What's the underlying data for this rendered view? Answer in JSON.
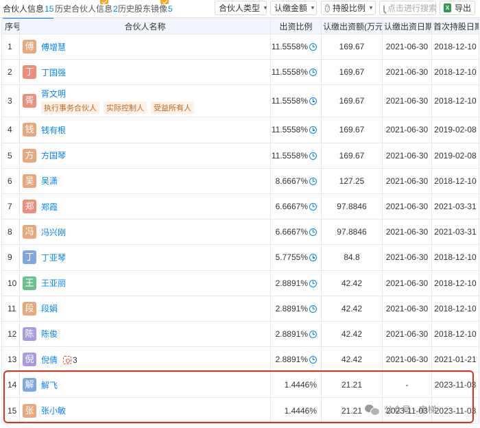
{
  "tabs": [
    {
      "label": "合伙人信息",
      "count": "15"
    },
    {
      "label": "历史合伙人信息",
      "count": "2"
    },
    {
      "label": "历史股东镜像",
      "count": "5"
    }
  ],
  "toolbar": {
    "partner_type": "合伙人类型",
    "amount": "认缴金额",
    "ratio": "持股比例",
    "search_placeholder": "点击进行搜索",
    "export": "导出"
  },
  "columns": [
    "序号",
    "合伙人名称",
    "出资比例",
    "认缴出资额(万元)",
    "认缴出资日期",
    "首次持股日期"
  ],
  "rows": [
    {
      "seq": "1",
      "avatar_char": "傅",
      "avatar_color": "#e8a87c",
      "name": "傅增慧",
      "ratio": "11.5558%",
      "amount": "169.67",
      "sub_date": "2021-06-30",
      "first_date": "2018-12-10"
    },
    {
      "seq": "2",
      "avatar_char": "丁",
      "avatar_color": "#ee8d7a",
      "name": "丁国强",
      "ratio": "11.5558%",
      "amount": "169.67",
      "sub_date": "2021-06-30",
      "first_date": "2018-12-10"
    },
    {
      "seq": "3",
      "avatar_char": "胥",
      "avatar_color": "#ee8d7a",
      "name": "胥文明",
      "tags": [
        "执行事务合伙人",
        "实际控制人",
        "受益所有人"
      ],
      "ratio": "11.5558%",
      "amount": "169.67",
      "sub_date": "2021-06-30",
      "first_date": "2018-12-10"
    },
    {
      "seq": "4",
      "avatar_char": "钱",
      "avatar_color": "#e8a87c",
      "name": "钱有根",
      "ratio": "11.5558%",
      "amount": "169.67",
      "sub_date": "2021-06-30",
      "first_date": "2019-02-08"
    },
    {
      "seq": "5",
      "avatar_char": "方",
      "avatar_color": "#e8a87c",
      "name": "方国琴",
      "ratio": "11.5558%",
      "amount": "169.67",
      "sub_date": "2021-06-30",
      "first_date": "2019-02-08"
    },
    {
      "seq": "6",
      "avatar_char": "吴",
      "avatar_color": "#e8a87c",
      "name": "吴潇",
      "ratio": "8.6667%",
      "amount": "127.25",
      "sub_date": "2021-06-30",
      "first_date": "2018-12-10"
    },
    {
      "seq": "7",
      "avatar_char": "郑",
      "avatar_color": "#ee8d7a",
      "name": "郑霞",
      "ratio": "6.6667%",
      "amount": "97.8846",
      "sub_date": "2021-06-30",
      "first_date": "2021-03-31"
    },
    {
      "seq": "8",
      "avatar_char": "冯",
      "avatar_color": "#e8a87c",
      "name": "冯兴刚",
      "ratio": "6.6667%",
      "amount": "97.8846",
      "sub_date": "2021-06-30",
      "first_date": "2021-03-31"
    },
    {
      "seq": "9",
      "avatar_char": "丁",
      "avatar_color": "#7fa8e0",
      "name": "丁亚琴",
      "ratio": "5.7755%",
      "amount": "84.8",
      "sub_date": "2021-06-30",
      "first_date": "2018-12-10"
    },
    {
      "seq": "10",
      "avatar_char": "王",
      "avatar_color": "#6cc08b",
      "name": "王亚丽",
      "ratio": "2.8891%",
      "amount": "42.42",
      "sub_date": "2021-06-30",
      "first_date": "2018-12-10"
    },
    {
      "seq": "11",
      "avatar_char": "段",
      "avatar_color": "#e8a87c",
      "name": "段娟",
      "ratio": "2.8891%",
      "amount": "42.42",
      "sub_date": "2021-06-30",
      "first_date": "2018-12-10"
    },
    {
      "seq": "12",
      "avatar_char": "陈",
      "avatar_color": "#a99be0",
      "name": "陈俊",
      "ratio": "2.8891%",
      "amount": "42.42",
      "sub_date": "2021-06-30",
      "first_date": "2018-12-10"
    },
    {
      "seq": "13",
      "avatar_char": "倪",
      "avatar_color": "#a99be0",
      "name": "倪倩",
      "link_count": "3",
      "ratio": "2.8891%",
      "amount": "42.42",
      "sub_date": "2021-06-30",
      "first_date": "2021-01-21"
    },
    {
      "seq": "14",
      "avatar_char": "解",
      "avatar_color": "#7fa8e0",
      "name": "解飞",
      "ratio": "1.4446%",
      "amount": "21.21",
      "sub_date": "-",
      "first_date": "2023-11-03"
    },
    {
      "seq": "15",
      "avatar_char": "张",
      "avatar_color": "#e8a87c",
      "name": "张小敏",
      "ratio": "1.4446%",
      "amount": "21.21",
      "sub_date": "2023-11-03",
      "first_date": "2023-11-03"
    }
  ],
  "watermark": "公众号 · 申梯"
}
